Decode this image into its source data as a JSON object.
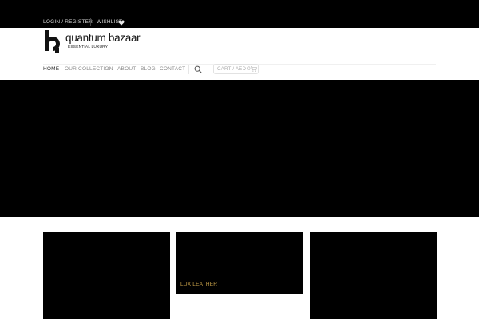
{
  "topbar": {
    "login_label": "LOGIN / REGISTER",
    "wishlist_label": "WISHLIST",
    "background": "#000000",
    "text_color": "#d8d8d8"
  },
  "brand": {
    "name": "quantum bazaar",
    "tagline": "ESSENTIAL LUXURY",
    "icon": "qb-logo-mark"
  },
  "nav": {
    "items": [
      {
        "label": "HOME",
        "active": true
      },
      {
        "label": "OUR COLLECTION",
        "has_dropdown": true
      },
      {
        "label": "ABOUT"
      },
      {
        "label": "BLOG"
      },
      {
        "label": "CONTACT"
      }
    ],
    "search_icon": "search-icon",
    "cart_label": "CART / AED 0",
    "cart_icon": "cart-icon"
  },
  "categories": [
    {
      "caption": ""
    },
    {
      "caption": "LUX LEATHER"
    },
    {
      "caption": ""
    }
  ],
  "colors": {
    "accent_gold": "#c9a24a",
    "dark": "#000000"
  }
}
